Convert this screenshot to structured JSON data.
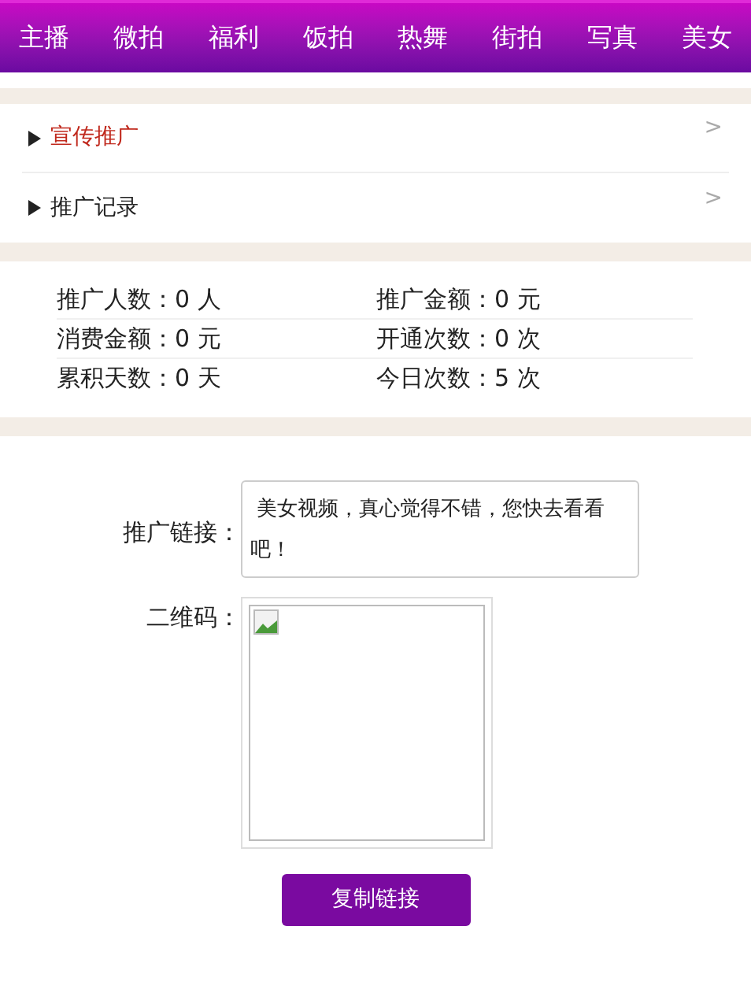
{
  "nav": [
    {
      "label": "主播"
    },
    {
      "label": "微拍"
    },
    {
      "label": "福利"
    },
    {
      "label": "饭拍"
    },
    {
      "label": "热舞"
    },
    {
      "label": "街拍"
    },
    {
      "label": "写真"
    },
    {
      "label": "美女"
    }
  ],
  "menu": [
    {
      "label": "宣传推广",
      "selected": true,
      "chevron": ">"
    },
    {
      "label": "推广记录",
      "selected": false,
      "chevron": ">"
    }
  ],
  "stats": [
    [
      "推广人数：0 人",
      "推广金额：0 元"
    ],
    [
      "消费金额：0 元",
      "开通次数：0 次"
    ],
    [
      "累积天数：0 天",
      "今日次数：5 次"
    ]
  ],
  "form": {
    "link_label": "推广链接：",
    "link_value": " 美女视频，真心觉得不错，您快去看看吧！",
    "qr_label": "二维码：",
    "button": "复制链接"
  }
}
